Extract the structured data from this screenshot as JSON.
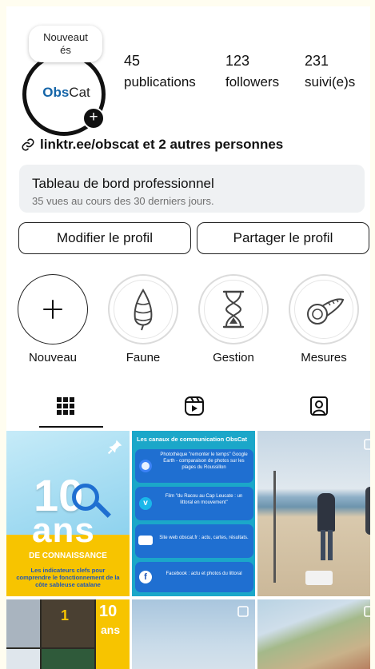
{
  "profile": {
    "tooltip": "Nouveautés",
    "logo_part1": "Obs",
    "logo_part2": "Cat",
    "stats": [
      {
        "value": "45",
        "label": "publications"
      },
      {
        "value": "123",
        "label": "followers"
      },
      {
        "value": "231",
        "label": "suivi(e)s"
      }
    ],
    "link_text": "linktr.ee/obscat et 2 autres personnes"
  },
  "dashboard": {
    "title": "Tableau de bord professionnel",
    "subtitle": "35 vues au cours des 30 derniers jours."
  },
  "buttons": {
    "edit": "Modifier le profil",
    "share": "Partager le profil"
  },
  "highlights": [
    {
      "label": "Nouveau",
      "icon": "plus-icon"
    },
    {
      "label": "Faune",
      "icon": "seashell-icon"
    },
    {
      "label": "Gestion",
      "icon": "hourglass-icon"
    },
    {
      "label": "Mesures",
      "icon": "measuring-tape-icon"
    }
  ],
  "tabs": [
    {
      "name": "grid",
      "icon": "grid-icon",
      "active": true
    },
    {
      "name": "reels",
      "icon": "reels-icon",
      "active": false
    },
    {
      "name": "tagged",
      "icon": "tagged-icon",
      "active": false
    }
  ],
  "posts": {
    "p1": {
      "number": "10",
      "word": "ans",
      "banner": "DE CONNAISSANCE",
      "caption": "Les indicateurs clefs pour comprendre le fonctionnement de la côte sableuse catalane"
    },
    "p2": {
      "title": "Les canaux de communication ObsCat",
      "items": [
        "Photothèque \"remonter le temps\" Google Earth - comparaison de photos sur les plages du Roussillon",
        "Film \"du Racou au Cap Leucate : un littoral en mouvement\"",
        "Site web obscat.fr : actu, cartes, résultats.",
        "Facebook : actu et photos du littoral"
      ]
    },
    "p4": {
      "number": "10",
      "word": "ans"
    }
  },
  "colors": {
    "yellow": "#f7c400",
    "blue": "#1f6fd1",
    "teal": "#1ba7c9",
    "dark_blue": "#1f56b8"
  }
}
